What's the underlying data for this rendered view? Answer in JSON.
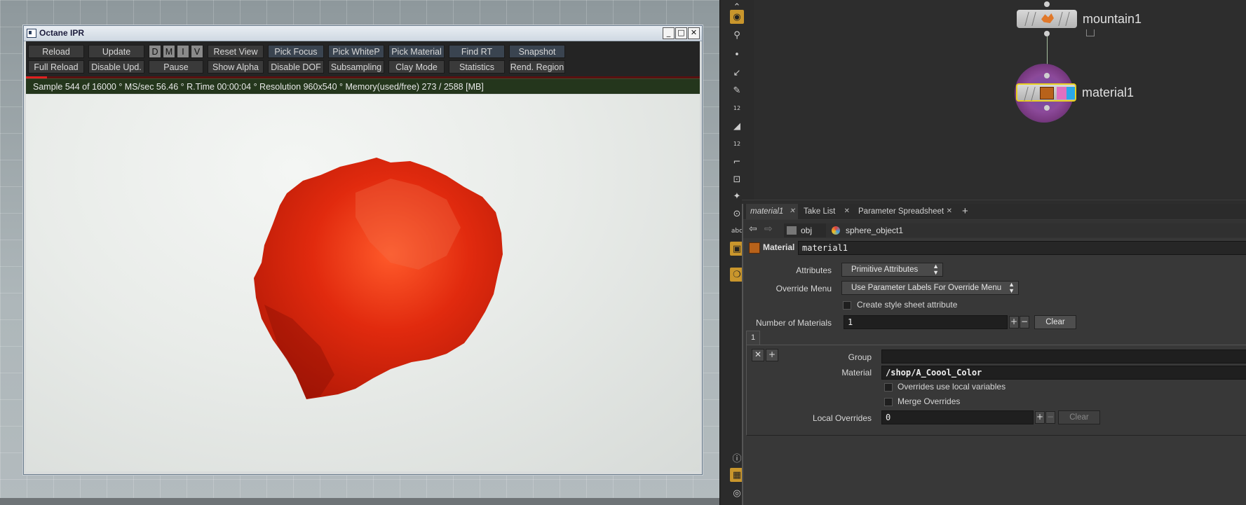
{
  "ipr": {
    "title": "Octane IPR",
    "window_buttons": [
      "_",
      "□",
      "✕"
    ],
    "row1": [
      "Reload",
      "Update",
      "D",
      "M",
      "I",
      "V",
      "Reset View",
      "Pick Focus",
      "Pick WhiteP",
      "Pick Material",
      "Find RT",
      "Snapshot"
    ],
    "row2": [
      "Full Reload",
      "Disable Upd.",
      "Pause",
      "Show Alpha",
      "Disable DOF",
      "Subsampling",
      "Clay Mode",
      "Statistics",
      "Rend. Region"
    ],
    "status": "Sample 544 of 16000 ° MS/sec 56.46 ° R.Time 00:00:04 ° Resolution 960x540 ° Memory(used/free) 273 / 2588 [MB]"
  },
  "nodes": {
    "top": "mountain1",
    "bottom": "material1"
  },
  "tabs": [
    "material1",
    "Take List",
    "Parameter Spreadsheet"
  ],
  "tab_add": "+",
  "path": {
    "first": "obj",
    "second": "sphere_object1"
  },
  "node_header": {
    "type": "Material",
    "name": "material1"
  },
  "params": {
    "attributes_label": "Attributes",
    "attributes_value": "Primitive Attributes",
    "override_menu_label": "Override Menu",
    "override_menu_value": "Use Parameter Labels For Override Menu",
    "style_sheet_label": "Create style sheet attribute",
    "num_materials_label": "Number of Materials",
    "num_materials_value": "1",
    "clear_label": "Clear",
    "multi_tab": "1",
    "group_label": "Group",
    "group_value": "",
    "material_label": "Material",
    "material_value": "/shop/A_Coool_Color",
    "overrides_local_label": "Overrides use local variables",
    "merge_overrides_label": "Merge Overrides",
    "local_overrides_label": "Local Overrides",
    "local_overrides_value": "0",
    "clear2_label": "Clear"
  },
  "toolbar_text": {
    "n12a": "12",
    "n12b": "12",
    "abc": "abc"
  },
  "colors": {
    "rock": "#d42a10",
    "status_bg": "#24361c",
    "accent": "#c9962c"
  }
}
